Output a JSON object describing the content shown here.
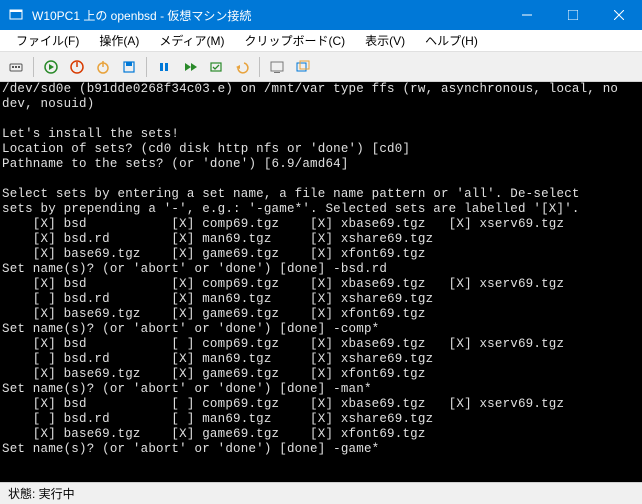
{
  "titlebar": {
    "title": "W10PC1 上の openbsd - 仮想マシン接続"
  },
  "menu": {
    "file": "ファイル(F)",
    "action": "操作(A)",
    "media": "メディア(M)",
    "clipboard": "クリップボード(C)",
    "view": "表示(V)",
    "help": "ヘルプ(H)"
  },
  "statusbar": {
    "label": "状態: 実行中"
  },
  "terminal": {
    "lines": [
      "/dev/sd0e (b91dde0268f34c03.e) on /mnt/var type ffs (rw, asynchronous, local, no",
      "dev, nosuid)",
      "",
      "Let's install the sets!",
      "Location of sets? (cd0 disk http nfs or 'done') [cd0]",
      "Pathname to the sets? (or 'done') [6.9/amd64]",
      "",
      "Select sets by entering a set name, a file name pattern or 'all'. De-select",
      "sets by prepending a '-', e.g.: '-game*'. Selected sets are labelled '[X]'.",
      "    [X] bsd           [X] comp69.tgz    [X] xbase69.tgz   [X] xserv69.tgz",
      "    [X] bsd.rd        [X] man69.tgz     [X] xshare69.tgz",
      "    [X] base69.tgz    [X] game69.tgz    [X] xfont69.tgz",
      "Set name(s)? (or 'abort' or 'done') [done] -bsd.rd",
      "    [X] bsd           [X] comp69.tgz    [X] xbase69.tgz   [X] xserv69.tgz",
      "    [ ] bsd.rd        [X] man69.tgz     [X] xshare69.tgz",
      "    [X] base69.tgz    [X] game69.tgz    [X] xfont69.tgz",
      "Set name(s)? (or 'abort' or 'done') [done] -comp*",
      "    [X] bsd           [ ] comp69.tgz    [X] xbase69.tgz   [X] xserv69.tgz",
      "    [ ] bsd.rd        [X] man69.tgz     [X] xshare69.tgz",
      "    [X] base69.tgz    [X] game69.tgz    [X] xfont69.tgz",
      "Set name(s)? (or 'abort' or 'done') [done] -man*",
      "    [X] bsd           [ ] comp69.tgz    [X] xbase69.tgz   [X] xserv69.tgz",
      "    [ ] bsd.rd        [ ] man69.tgz     [X] xshare69.tgz",
      "    [X] base69.tgz    [X] game69.tgz    [X] xfont69.tgz",
      "Set name(s)? (or 'abort' or 'done') [done] -game*"
    ]
  }
}
